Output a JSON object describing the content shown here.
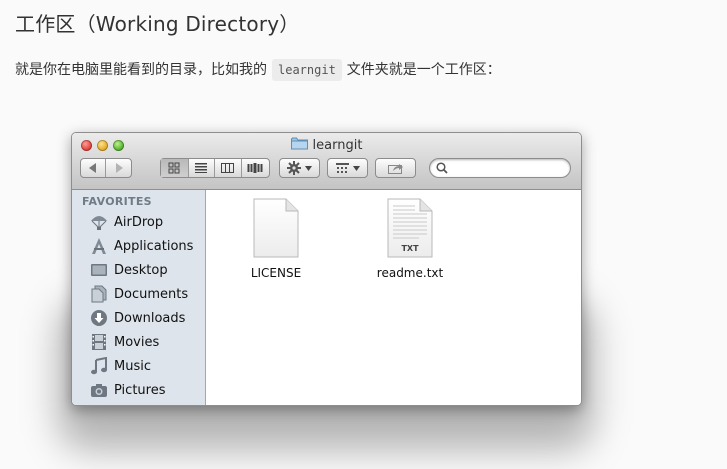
{
  "heading": "工作区（Working Directory）",
  "paragraph": {
    "before": "就是你在电脑里能看到的目录，比如我的",
    "code": "learngit",
    "after": "文件夹就是一个工作区："
  },
  "window": {
    "title": "learngit",
    "sidebar": {
      "section_label": "FAVORITES",
      "items": [
        {
          "label": "AirDrop",
          "icon": "airdrop-icon"
        },
        {
          "label": "Applications",
          "icon": "applications-icon"
        },
        {
          "label": "Desktop",
          "icon": "desktop-icon"
        },
        {
          "label": "Documents",
          "icon": "documents-icon"
        },
        {
          "label": "Downloads",
          "icon": "downloads-icon"
        },
        {
          "label": "Movies",
          "icon": "movies-icon"
        },
        {
          "label": "Music",
          "icon": "music-icon"
        },
        {
          "label": "Pictures",
          "icon": "pictures-icon"
        }
      ]
    },
    "files": [
      {
        "name": "LICENSE",
        "badge": ""
      },
      {
        "name": "readme.txt",
        "badge": "TXT"
      }
    ]
  }
}
